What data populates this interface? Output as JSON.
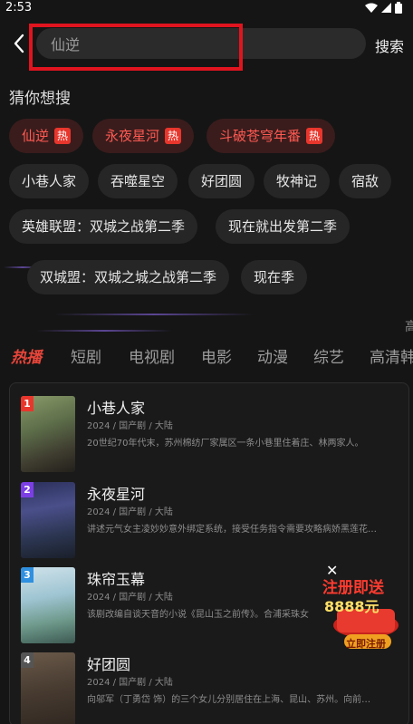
{
  "status": {
    "time": "2:53"
  },
  "search": {
    "value": "仙逆",
    "button_label": "搜索"
  },
  "suggest": {
    "title": "猜你想搜",
    "hot_badge": "热",
    "hot_chips": [
      "仙逆",
      "永夜星河",
      "斗破苍穹年番"
    ],
    "chips_row2": [
      "小巷人家",
      "吞噬星空",
      "好团圆",
      "牧神记",
      "宿敌"
    ],
    "chips_row3": [
      "英雄联盟：双城之战第二季",
      "现在就出发第二季"
    ],
    "chips_row4": [
      "双城盟：双城之城之战第二季",
      "现在季"
    ],
    "edge_glyph": "高"
  },
  "tabs": [
    "热播",
    "短剧",
    "电视剧",
    "电影",
    "动漫",
    "综艺",
    "高清韩"
  ],
  "list": [
    {
      "rank": "1",
      "title": "小巷人家",
      "meta": "2024 / 国产剧 / 大陆",
      "desc": "20世纪70年代末，苏州棉纺厂家属区一条小巷里住着庄、林两家人。"
    },
    {
      "rank": "2",
      "title": "永夜星河",
      "meta": "2024 / 国产剧 / 大陆",
      "desc": "讲述元气女主凌妙妙意外绑定系统，接受任务指令需要攻略病娇黑莲花…"
    },
    {
      "rank": "3",
      "title": "珠帘玉幕",
      "meta": "2024 / 国产剧 / 大陆",
      "desc": "该剧改编自谈天音的小说《昆山玉之前传》。合浦采珠女"
    },
    {
      "rank": "4",
      "title": "好团圆",
      "meta": "2024 / 国产剧 / 大陆",
      "desc": "向邬军（丁勇岱 饰）的三个女儿分别居住在上海、昆山、苏州。向前…"
    }
  ],
  "promo": {
    "line1": "注册即送",
    "line2": "8888元",
    "button": "立即注册",
    "close": "✕"
  },
  "colors": {
    "accent": "#e8453a",
    "hot_bg": "#3a1c1c",
    "chip_bg": "#262626",
    "bg": "#151515",
    "rank1": "#e8362c",
    "rank2": "#7b3fe4",
    "rank3": "#2f8fe0",
    "rank4": "#555555"
  },
  "icons": [
    "wifi-icon",
    "signal-icon",
    "battery-icon",
    "back-arrow-icon",
    "close-icon"
  ]
}
